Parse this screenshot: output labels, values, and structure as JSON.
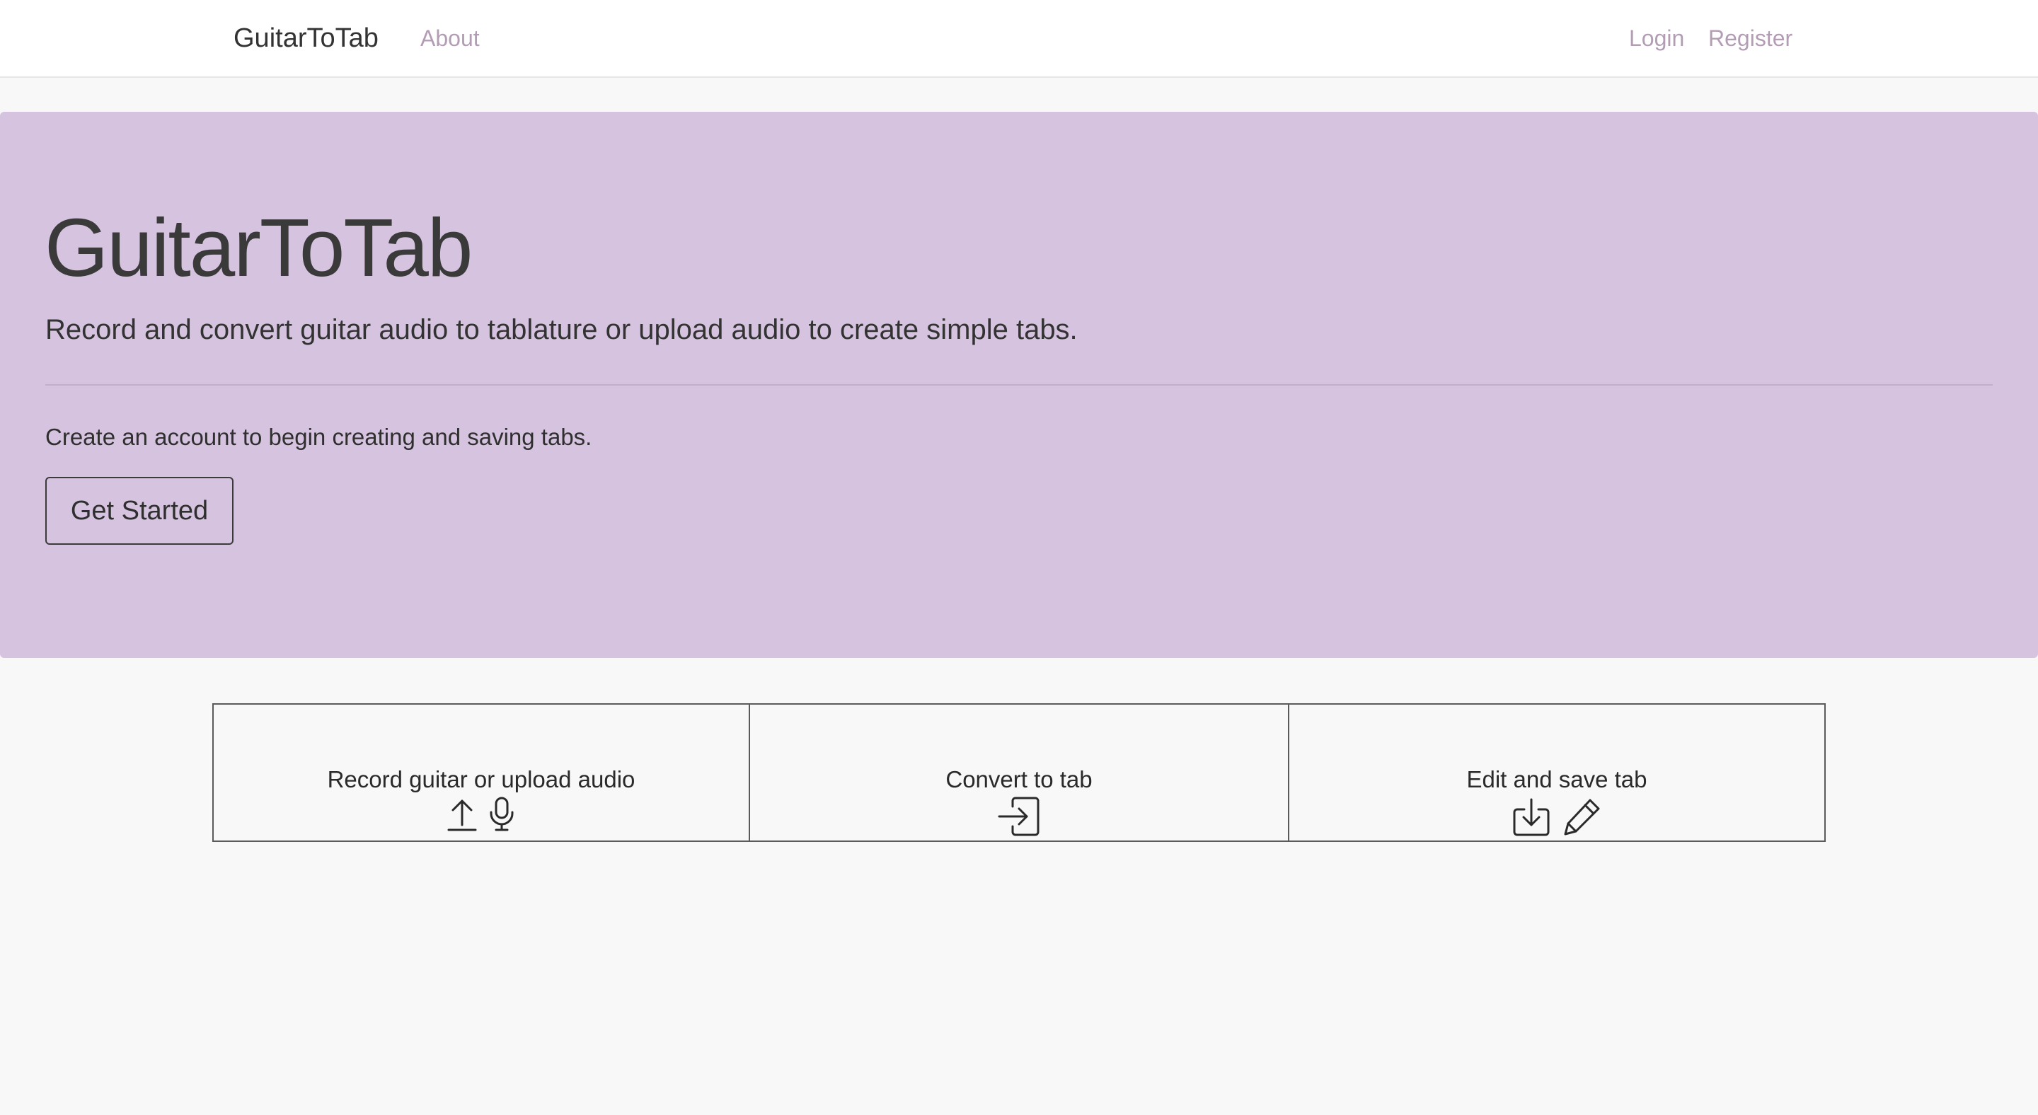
{
  "navbar": {
    "brand": "GuitarToTab",
    "links": {
      "about": "About",
      "login": "Login",
      "register": "Register"
    },
    "link_color": "#b39db4"
  },
  "hero": {
    "title": "GuitarToTab",
    "lead": "Record and convert guitar audio to tablature or upload audio to create simple tabs.",
    "text": "Create an account to begin creating and saving tabs.",
    "button_label": "Get Started",
    "background_color": "#d5c3df"
  },
  "features": [
    {
      "label": "Record guitar or upload audio",
      "icons": [
        "upload-icon",
        "microphone-icon"
      ]
    },
    {
      "label": "Convert to tab",
      "icons": [
        "box-arrow-in-right-icon"
      ]
    },
    {
      "label": "Edit and save tab",
      "icons": [
        "download-icon",
        "pencil-icon"
      ]
    }
  ]
}
